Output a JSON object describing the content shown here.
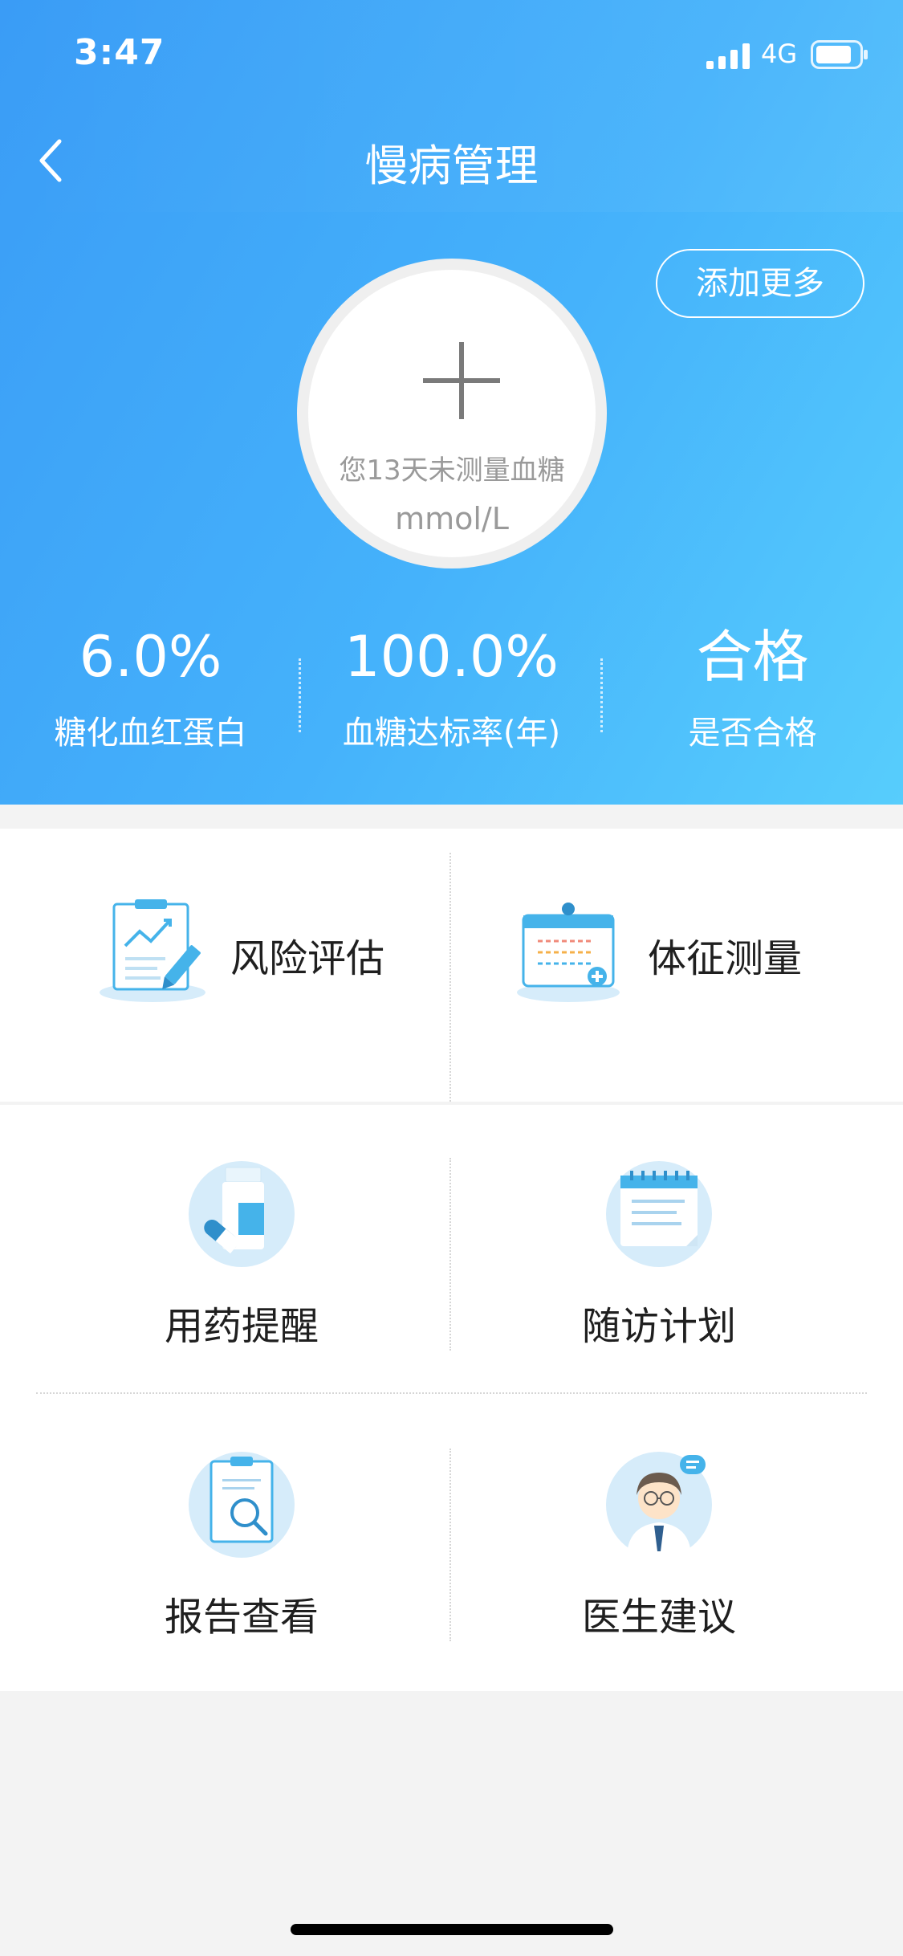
{
  "status_bar": {
    "time": "3:47",
    "network": "4G"
  },
  "nav": {
    "title": "慢病管理"
  },
  "header": {
    "add_more_label": "添加更多",
    "measure_hint": "您13天未测量血糖",
    "measure_unit": "mmol/L"
  },
  "stats": [
    {
      "value": "6.0%",
      "label": "糖化血红蛋白"
    },
    {
      "value": "100.0%",
      "label": "血糖达标率(年)"
    },
    {
      "value": "合格",
      "label": "是否合格"
    }
  ],
  "top_cards": [
    {
      "label": "风险评估",
      "icon": "risk-assessment-icon"
    },
    {
      "label": "体征测量",
      "icon": "vital-signs-icon"
    }
  ],
  "grid_items": [
    {
      "label": "用药提醒",
      "icon": "medication-icon"
    },
    {
      "label": "随访计划",
      "icon": "calendar-icon"
    },
    {
      "label": "报告查看",
      "icon": "report-search-icon"
    },
    {
      "label": "医生建议",
      "icon": "doctor-icon"
    }
  ],
  "colors": {
    "hero_gradient_start": "#3a9cf6",
    "hero_gradient_end": "#57cdfc",
    "icon_circle": "#d6ecfa",
    "icon_blue": "#45b3ea"
  }
}
